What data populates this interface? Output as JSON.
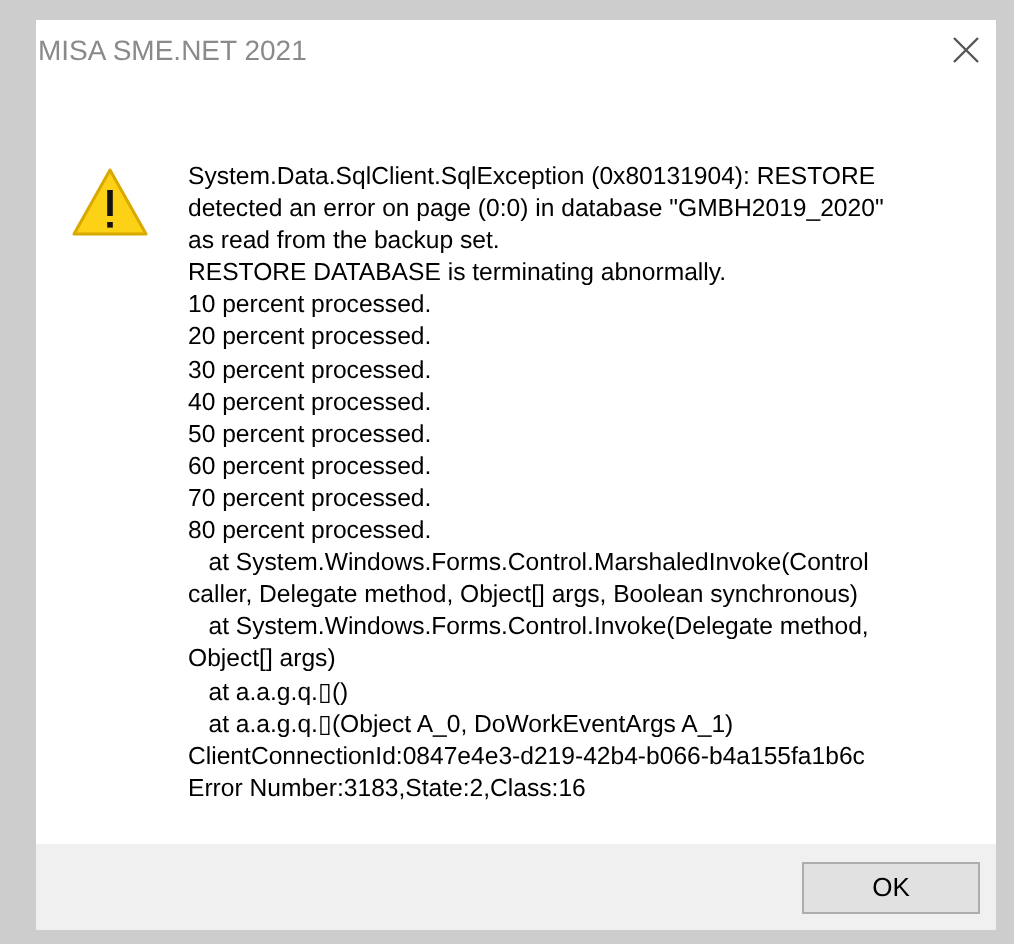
{
  "window": {
    "title": "MISA SME.NET 2021"
  },
  "message_lines": [
    "System.Data.SqlClient.SqlException (0x80131904): RESTORE",
    "detected an error on page (0:0) in database \"GMBH2019_2020\"",
    "as read from the backup set.",
    "RESTORE DATABASE is terminating abnormally.",
    "10 percent processed.",
    "20 percent processed.",
    "30 percent processed.",
    "40 percent processed.",
    "50 percent processed.",
    "60 percent processed.",
    "70 percent processed.",
    "80 percent processed.",
    "   at System.Windows.Forms.Control.MarshaledInvoke(Control",
    "caller, Delegate method, Object[] args, Boolean synchronous)",
    "   at System.Windows.Forms.Control.Invoke(Delegate method,",
    "Object[] args)",
    "   at a.a.g.q.▯()",
    "   at a.a.g.q.▯(Object A_0, DoWorkEventArgs A_1)",
    "ClientConnectionId:0847e4e3-d219-42b4-b066-b4a155fa1b6c",
    "Error Number:3183,State:2,Class:16"
  ],
  "buttons": [
    "OK"
  ]
}
